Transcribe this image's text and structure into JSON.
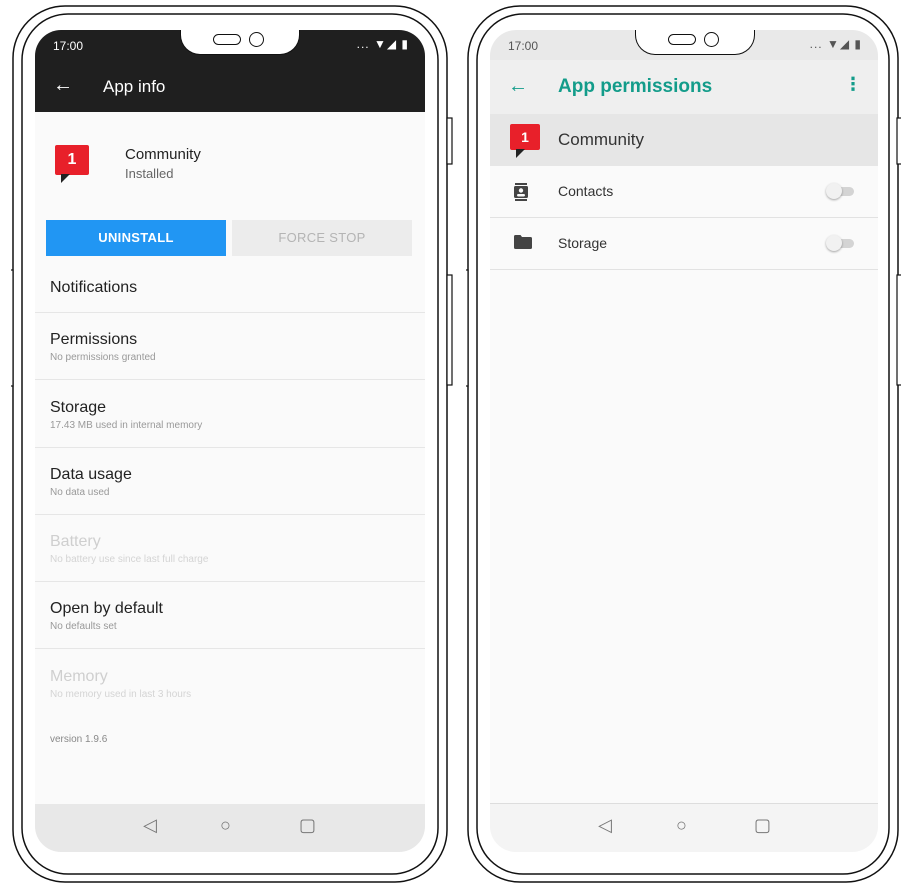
{
  "status_bar": {
    "time": "17:00",
    "icons": "... ▼◢ ▮"
  },
  "app_info": {
    "title": "App info",
    "app_name": "Community",
    "app_badge": "1",
    "app_status": "Installed",
    "uninstall_label": "UNINSTALL",
    "force_stop_label": "FORCE STOP",
    "notifications": "Notifications",
    "permissions": {
      "title": "Permissions",
      "subtitle": "No permissions granted"
    },
    "storage": {
      "title": "Storage",
      "subtitle": "17.43 MB used in internal memory"
    },
    "data_usage": {
      "title": "Data usage",
      "subtitle": "No data used"
    },
    "battery": {
      "title": "Battery",
      "subtitle": "No battery use since last full charge"
    },
    "open_by_default": {
      "title": "Open by default",
      "subtitle": "No defaults set"
    },
    "memory": {
      "title": "Memory",
      "subtitle": "No memory used in last 3 hours"
    },
    "version": "version 1.9.6"
  },
  "app_permissions": {
    "title": "App permissions",
    "app_name": "Community",
    "app_badge": "1",
    "contacts": {
      "label": "Contacts",
      "enabled": false
    },
    "storage": {
      "label": "Storage",
      "enabled": false
    }
  },
  "nav": {
    "back": "◁",
    "home": "○",
    "recents": "▢"
  },
  "colors": {
    "accent_blue": "#2196f3",
    "teal": "#139c8a",
    "brand_red": "#e8202a"
  }
}
